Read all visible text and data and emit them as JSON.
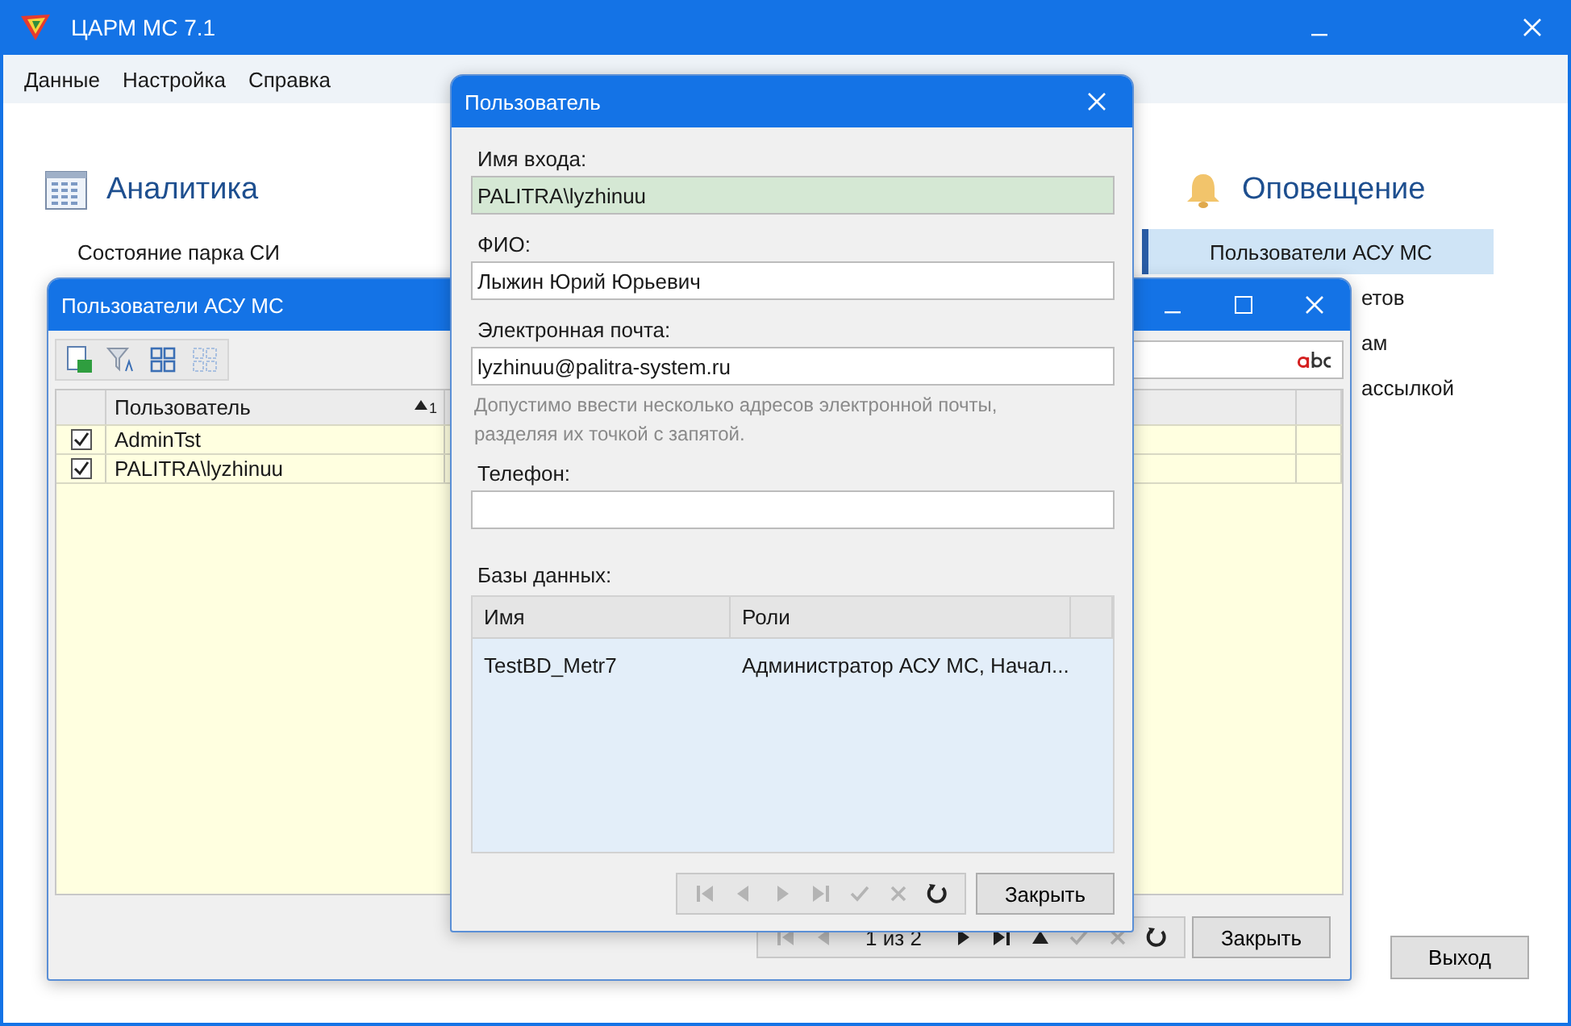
{
  "app": {
    "title": "ЦАРМ МС 7.1",
    "menu": [
      "Данные",
      "Настройка",
      "Справка"
    ]
  },
  "sections": [
    {
      "kind": "analytics",
      "title": "Аналитика",
      "items": [
        {
          "label": "Состояние парка СИ",
          "selected": false
        }
      ]
    },
    {
      "kind": "notify",
      "title": "Оповещение",
      "items": [
        {
          "label": "Пользователи АСУ МС",
          "selected": true
        },
        {
          "label": "етов",
          "selected": false
        },
        {
          "label": "ам",
          "selected": false
        },
        {
          "label": "ассылкой",
          "selected": false
        }
      ]
    }
  ],
  "exit_button": "Выход",
  "users_window": {
    "title": "Пользователи АСУ МС",
    "column_header": "Пользователь",
    "sort_order": "1",
    "rows": [
      {
        "checked": true,
        "user": "AdminTst"
      },
      {
        "checked": true,
        "user": "PALITRA\\lyzhinuu"
      }
    ],
    "pager": {
      "position": "1 из 2",
      "buttons": [
        {
          "kind": "first",
          "disabled": true
        },
        {
          "kind": "prev",
          "disabled": true
        },
        {
          "kind": "pos"
        },
        {
          "kind": "next",
          "disabled": false
        },
        {
          "kind": "last",
          "disabled": false
        },
        {
          "kind": "up",
          "disabled": false
        },
        {
          "kind": "check",
          "disabled": true
        },
        {
          "kind": "cancel",
          "disabled": true
        },
        {
          "kind": "refresh",
          "disabled": false
        }
      ]
    },
    "close_button": "Закрыть"
  },
  "dialog": {
    "title": "Пользователь",
    "fields": [
      {
        "label": "Имя входа:",
        "value": "PALITRA\\lyzhinuu",
        "readonly": true
      },
      {
        "label": "ФИО:",
        "value": "Лыжин Юрий Юрьевич",
        "readonly": false
      },
      {
        "label": "Электронная почта:",
        "value": "lyzhinuu@palitra-system.ru",
        "readonly": false,
        "hint": "Допустимо ввести несколько адресов электронной почты, разделяя их точкой с запятой."
      },
      {
        "label": "Телефон:",
        "readonly": false
      }
    ],
    "databases_label": "Базы данных:",
    "columns": [
      "Имя",
      "Роли"
    ],
    "rows": [
      {
        "name": "TestBD_Metr7",
        "roles": "Администратор АСУ МС, Начал..."
      }
    ],
    "pager": {
      "buttons": [
        {
          "kind": "first",
          "disabled": true
        },
        {
          "kind": "prev",
          "disabled": true
        },
        {
          "kind": "next",
          "disabled": true
        },
        {
          "kind": "last",
          "disabled": true
        },
        {
          "kind": "check",
          "disabled": true
        },
        {
          "kind": "cancel",
          "disabled": true
        },
        {
          "kind": "refresh",
          "disabled": false
        }
      ]
    },
    "close_button": "Закрыть"
  }
}
